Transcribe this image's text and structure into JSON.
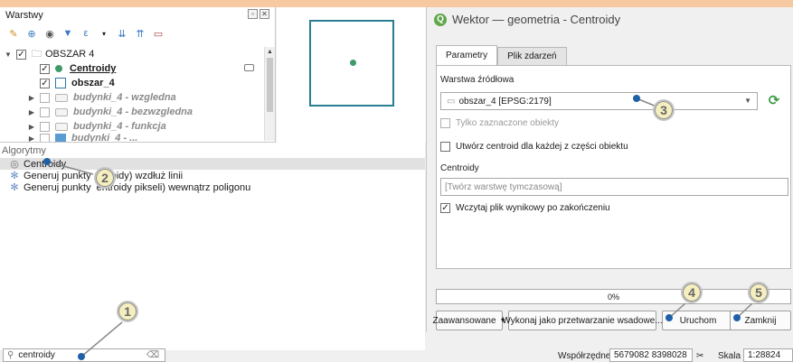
{
  "layers_panel": {
    "title": "Warstwy",
    "group": "OBSZAR 4",
    "layers": [
      {
        "name": "Centroidy",
        "checked": true
      },
      {
        "name": "obszar_4",
        "checked": true
      },
      {
        "name": "budynki_4 - wzgledna",
        "checked": false
      },
      {
        "name": "budynki_4 - bezwzgledna",
        "checked": false
      },
      {
        "name": "budynki_4 - funkcja",
        "checked": false
      },
      {
        "name": "budynki_4 - ...",
        "checked": false
      }
    ],
    "toolbar_icons": [
      "paint-style-icon",
      "add-group-icon",
      "eye-icon",
      "filter-icon",
      "expression-filter-icon",
      "expand-all-icon",
      "collapse-all-icon",
      "remove-layer-icon"
    ]
  },
  "toolbox": {
    "header": "Algorytmy",
    "items": [
      {
        "label": "Centroidy",
        "icon": "centroid-icon"
      },
      {
        "label": "Generuj punkty (centroidy) wzdłuż linii",
        "icon": "gear-icon"
      },
      {
        "label": "Generuj punkty (centroidy pikseli) wewnątrz poligonu",
        "icon": "gear-icon"
      }
    ],
    "visible_fragments": {
      "item2_left": "Generuj punkty",
      "item2_right": "oidy) wzdłuż linii",
      "item3_left": "Generuj punkty",
      "item3_right": "entroidy pikseli) wewnątrz poligonu"
    }
  },
  "dialog": {
    "title": "Wektor — geometria - Centroidy",
    "tabs": [
      "Parametry",
      "Plik zdarzeń"
    ],
    "source_layer_label": "Warstwa źródłowa",
    "source_layer_value": "obszar_4 [EPSG:2179]",
    "selected_only_label": "Tylko zaznaczone obiekty",
    "each_part_label": "Utwórz centroid dla każdej z części obiektu",
    "output_label": "Centroidy",
    "output_placeholder": "[Twórz warstwę tymczasową]",
    "open_output_label": "Wczytaj plik wynikowy po zakończeniu",
    "progress_text": "0%",
    "buttons": {
      "advanced": "Zaawansowane",
      "batch": "Wykonaj jako przetwarzanie wsadowe...",
      "run": "Uruchom",
      "close": "Zamknij"
    }
  },
  "status_bar": {
    "search_value": "centroidy",
    "coordinates_label": "Współrzędne",
    "coordinates_value": "5679082 8398028",
    "scale_label": "Skala",
    "scale_value": "1:28824"
  },
  "markers": [
    "1",
    "2",
    "3",
    "4",
    "5"
  ],
  "colors": {
    "marker_fill": "#f5efc0",
    "marker_dot": "#1f5fa8",
    "point_symbol": "#3f9a6b",
    "polygon_border": "#2a7e93"
  }
}
